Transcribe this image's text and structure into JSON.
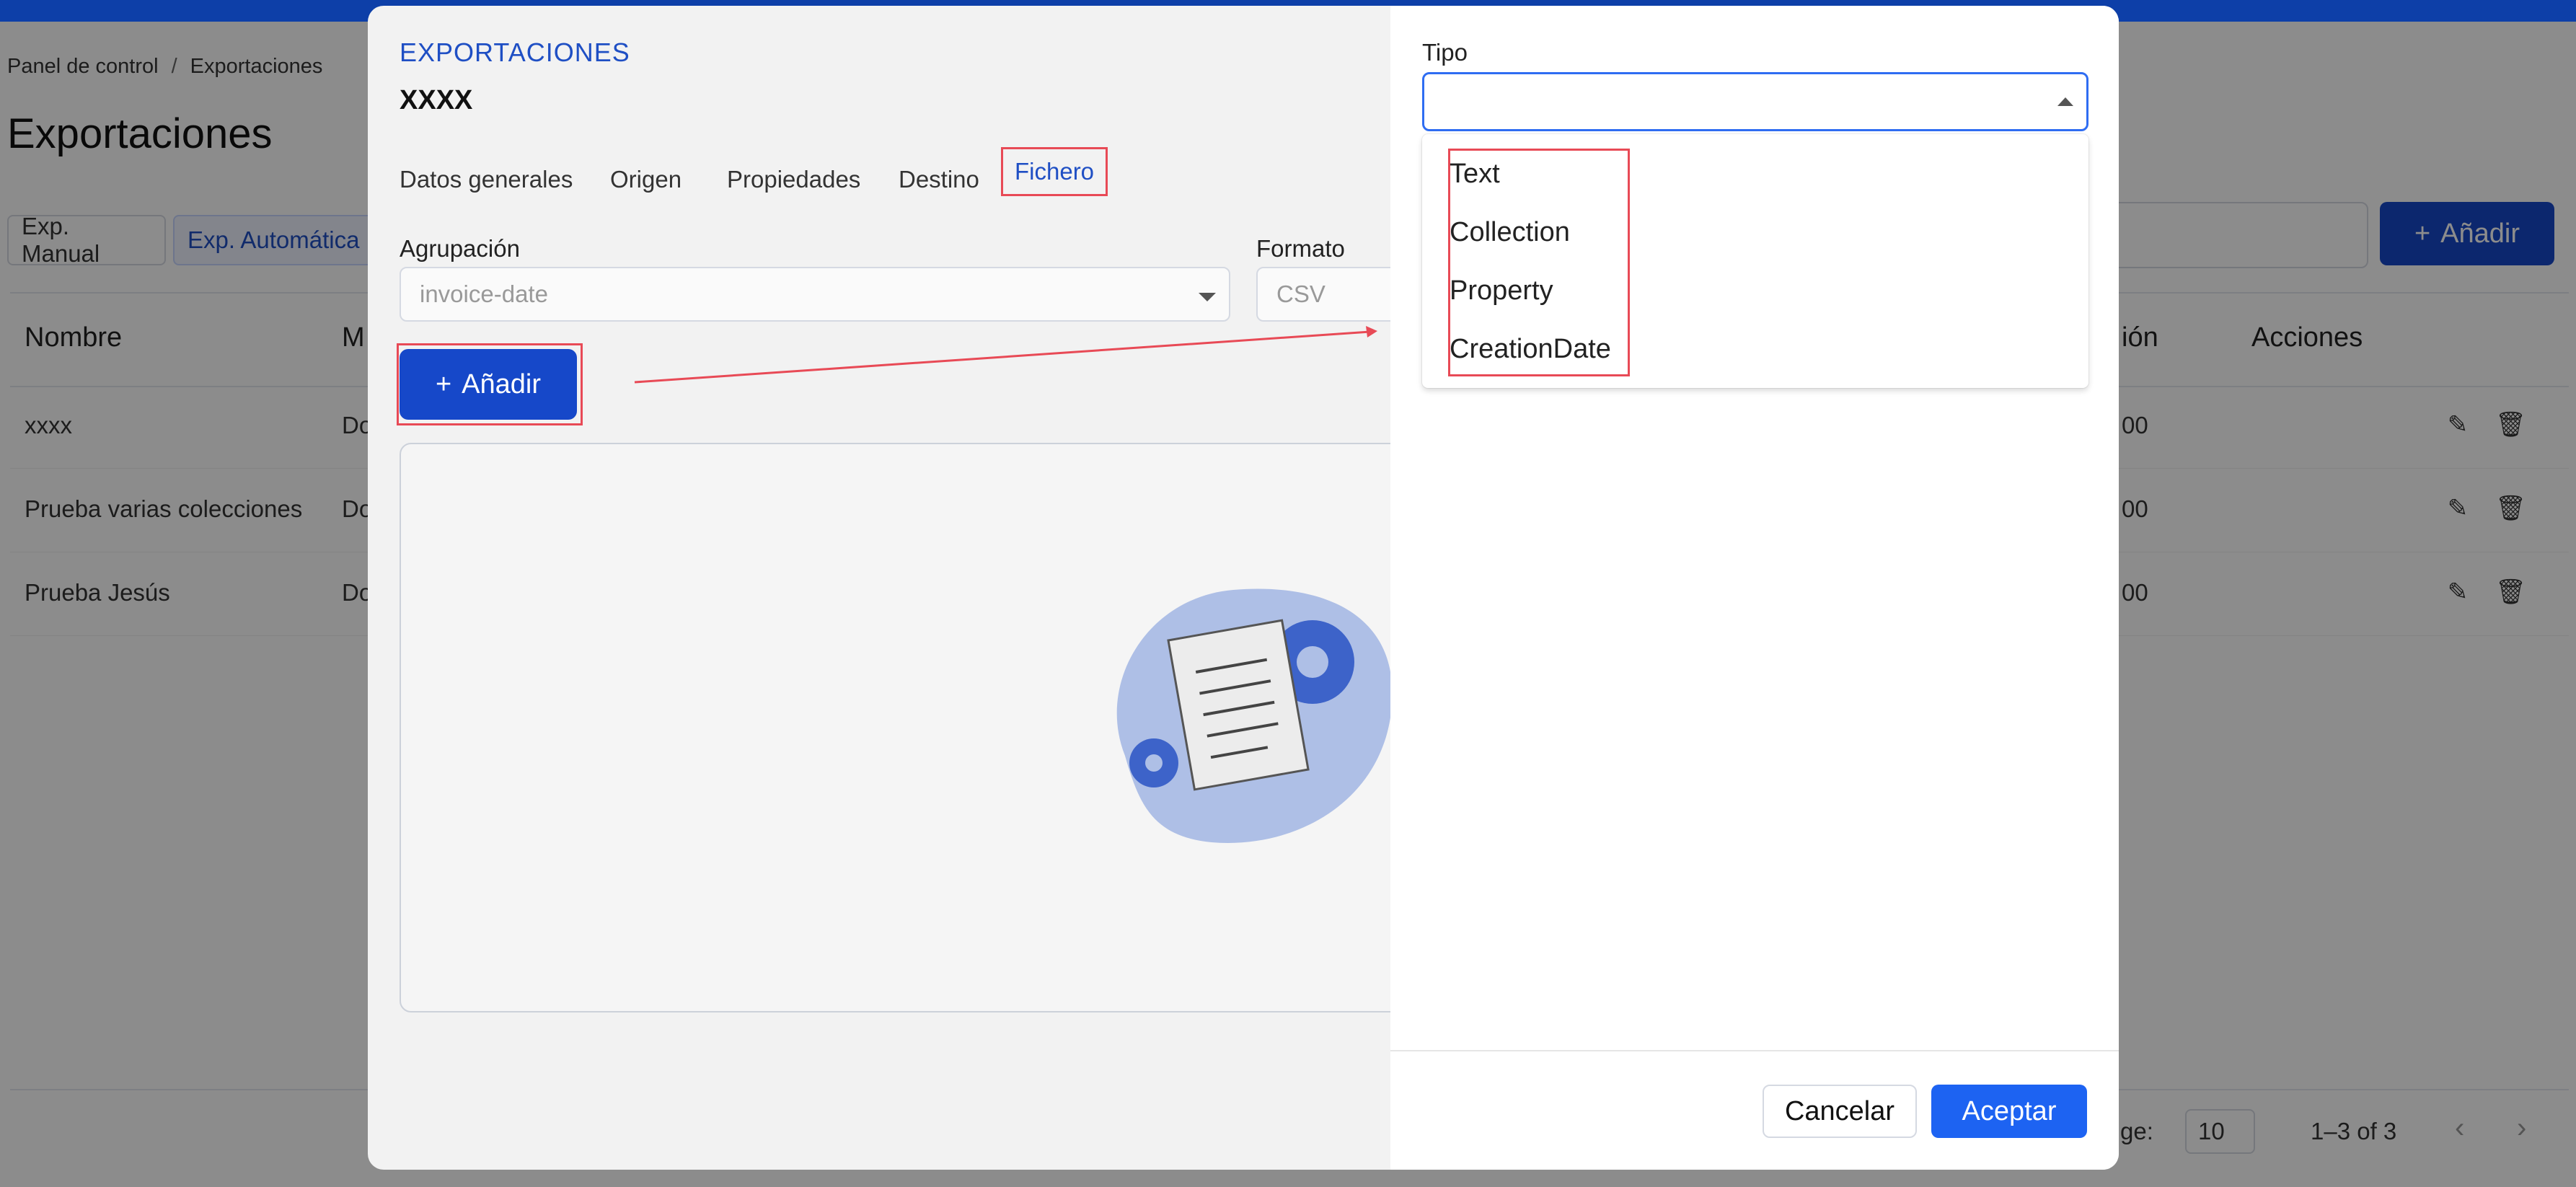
{
  "background": {
    "breadcrumb": [
      "Panel de control",
      "/",
      "Exportaciones"
    ],
    "page_title": "Exportaciones",
    "tabs": [
      "Exp. Manual",
      "Exp. Automática"
    ],
    "add_button": "Añadir",
    "table_headers": [
      "Nombre",
      "M",
      "ión",
      "Acciones"
    ],
    "rows": [
      {
        "name": "xxxx",
        "col2": "Do",
        "col3": "00"
      },
      {
        "name": "Prueba varias colecciones",
        "col2": "Do",
        "col3": "00"
      },
      {
        "name": "Prueba Jesús",
        "col2": "Do",
        "col3": "00"
      }
    ],
    "footer": {
      "rows_label": "ge:",
      "page_size": "10",
      "range": "1–3 of 3"
    }
  },
  "modal": {
    "section": "EXPORTACIONES",
    "name": "XXXX",
    "tabs": [
      "Datos generales",
      "Origen",
      "Propiedades",
      "Destino",
      "Fichero"
    ],
    "active_tab": "Fichero",
    "agrupacion_label": "Agrupación",
    "agrupacion_value": "invoice-date",
    "formato_label": "Formato",
    "formato_value": "CSV",
    "add_button": "Añadir"
  },
  "drawer": {
    "tipo_label": "Tipo",
    "tipo_value": "",
    "options": [
      "Text",
      "Collection",
      "Property",
      "CreationDate"
    ],
    "cancel": "Cancelar",
    "accept": "Aceptar"
  },
  "colors": {
    "primary": "#1648c9",
    "accent": "#1d63f2",
    "highlight": "#e84a56",
    "topbar": "#0d3fa8"
  }
}
